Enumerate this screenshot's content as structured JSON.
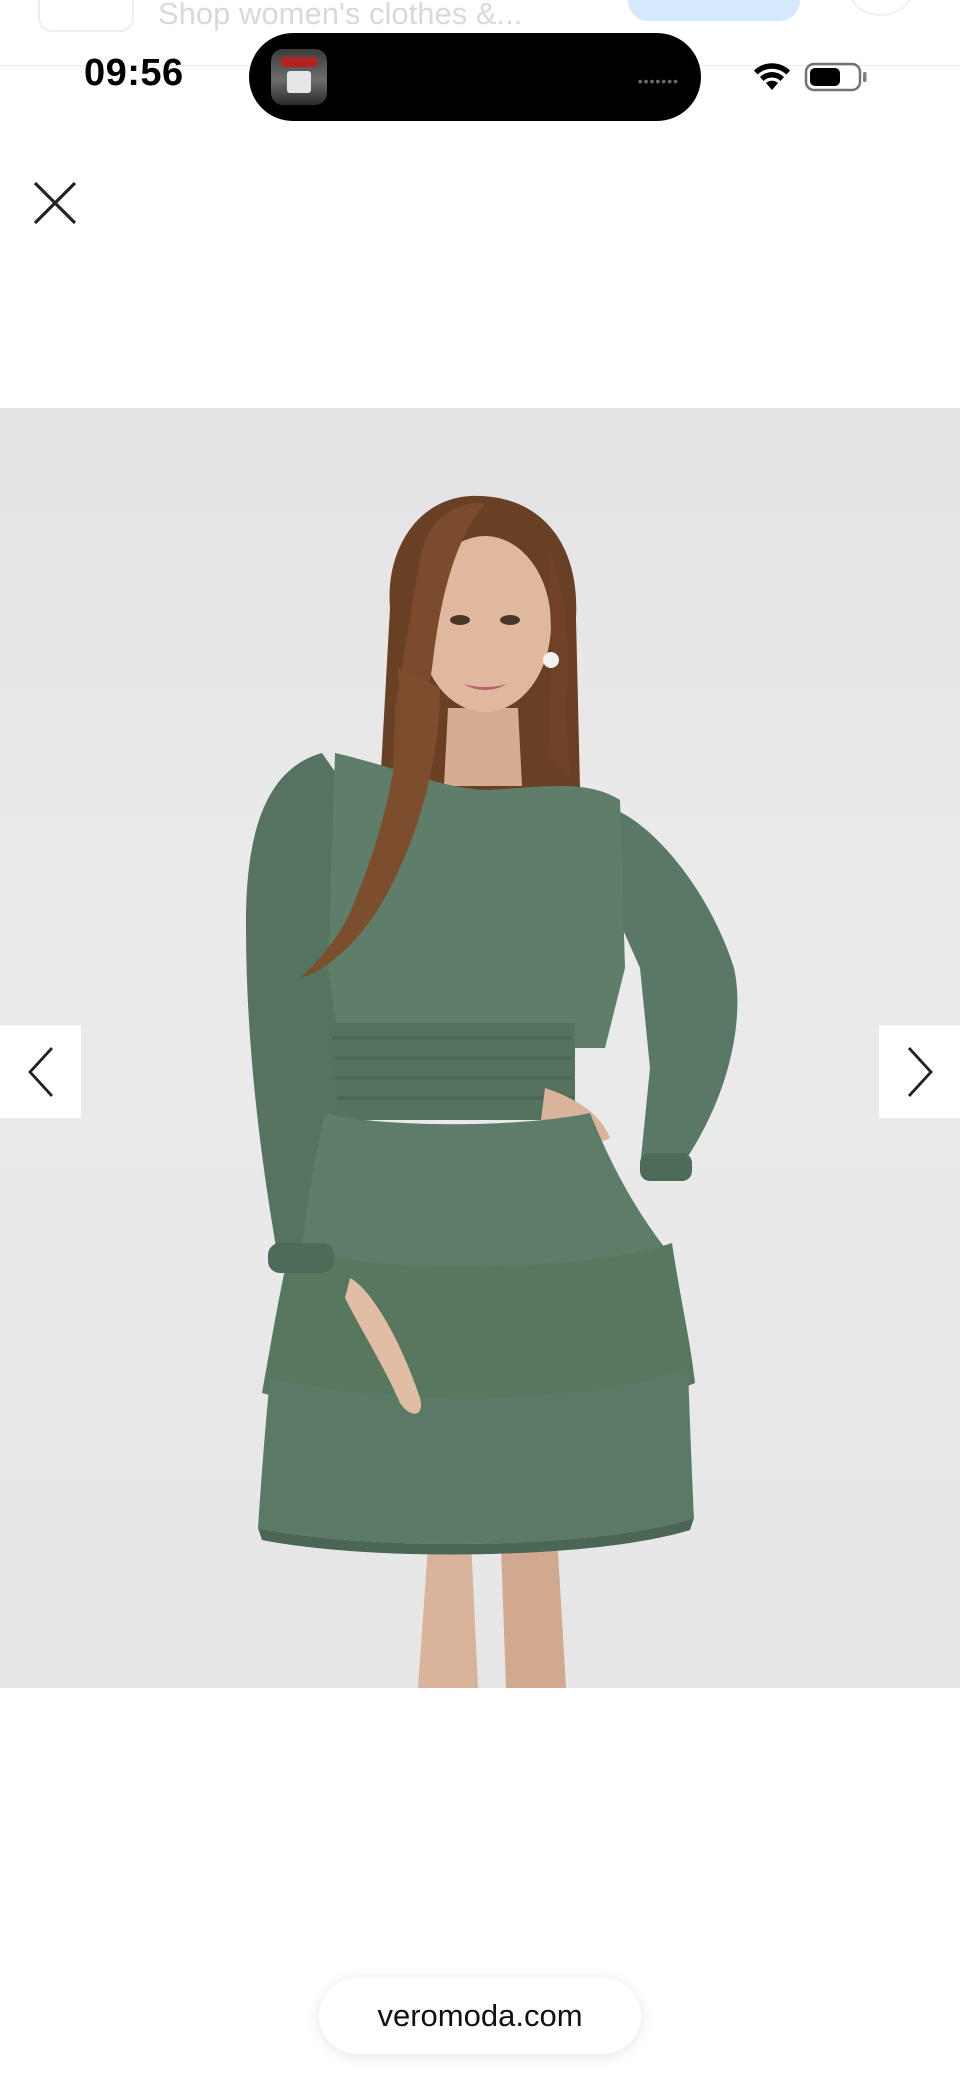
{
  "underlying_page": {
    "search_text": "Shop women's clothes &..."
  },
  "status_bar": {
    "time": "09:56",
    "island_indicator": "•••••••",
    "wifi_icon": "wifi-icon",
    "battery_icon": "battery-icon"
  },
  "viewer": {
    "close_icon": "close-icon",
    "prev_icon": "chevron-left-icon",
    "next_icon": "chevron-right-icon",
    "image_description": "Model wearing a green long-sleeve tiered ruffle mini dress",
    "background_color": "#e6e6e6",
    "dress_color": "#5b7b68"
  },
  "footer": {
    "domain": "veromoda.com"
  }
}
